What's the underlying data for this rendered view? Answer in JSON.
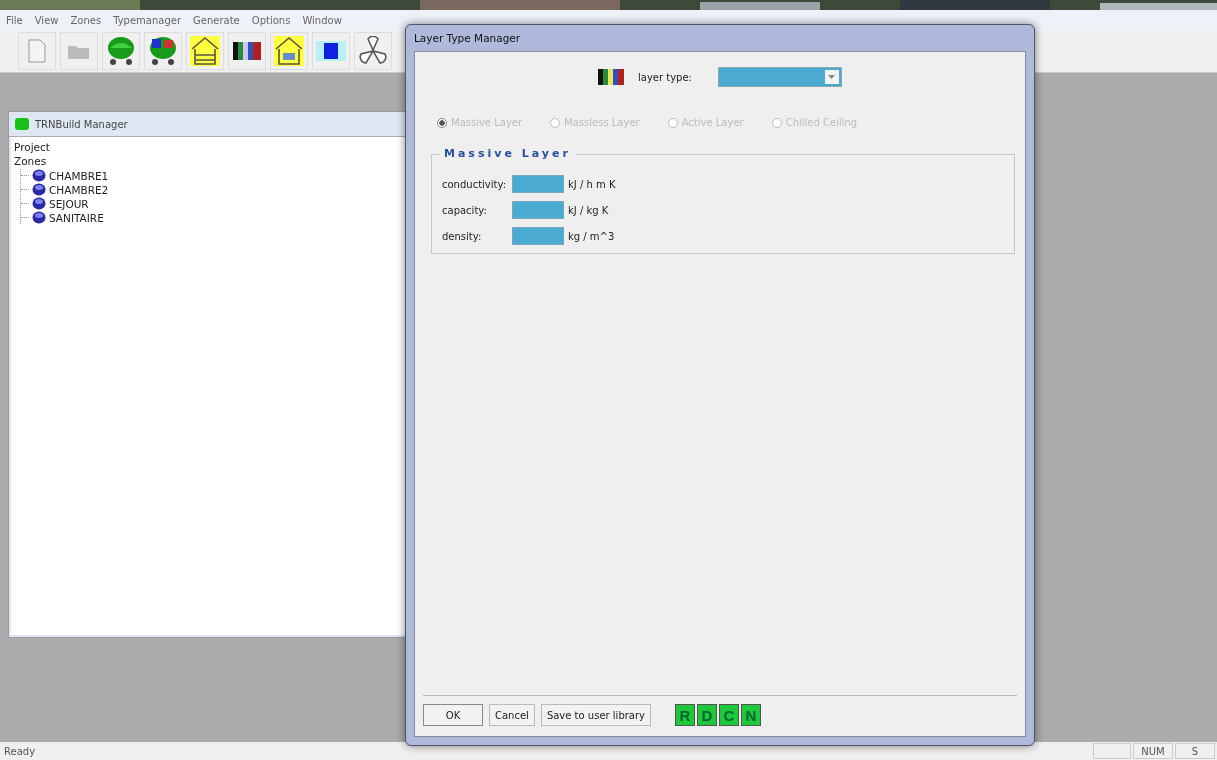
{
  "menu": [
    {
      "label": "File"
    },
    {
      "label": "View"
    },
    {
      "label": "Zones"
    },
    {
      "label": "Typemanager"
    },
    {
      "label": "Generate"
    },
    {
      "label": "Options"
    },
    {
      "label": "Window"
    }
  ],
  "toolbar": [
    {
      "kind": "new"
    },
    {
      "kind": "open"
    },
    {
      "kind": "zone"
    },
    {
      "kind": "zones"
    },
    {
      "kind": "building"
    },
    {
      "kind": "layers"
    },
    {
      "kind": "house-window"
    },
    {
      "kind": "square"
    },
    {
      "kind": "fan"
    }
  ],
  "manager": {
    "title": "TRNBuild Manager",
    "tree": [
      {
        "label": "Project"
      },
      {
        "label": "Zones",
        "children": [
          {
            "label": "CHAMBRE1"
          },
          {
            "label": "CHAMBRE2"
          },
          {
            "label": "SEJOUR"
          },
          {
            "label": "SANITAIRE"
          }
        ]
      }
    ]
  },
  "dialog": {
    "title": "Layer Type Manager",
    "layer_type_label": "layer type:",
    "options": [
      {
        "label": "Massive Layer",
        "selected": true,
        "disabled": true
      },
      {
        "label": "Massless Layer",
        "selected": false,
        "disabled": true
      },
      {
        "label": "Active Layer",
        "selected": false,
        "disabled": true
      },
      {
        "label": "Chilled Ceiling",
        "selected": false,
        "disabled": true
      }
    ],
    "group_title": "Massive Layer",
    "properties": [
      {
        "label": "conductivity:",
        "unit": "kJ / h m K"
      },
      {
        "label": "capacity:",
        "unit": "kJ / kg K"
      },
      {
        "label": "density:",
        "unit": "kg / m^3"
      }
    ],
    "buttons": [
      "OK",
      "Cancel",
      "Save to user library"
    ],
    "letter_buttons": [
      "R",
      "D",
      "C",
      "N"
    ]
  },
  "status_bar": {
    "message": "Ready",
    "indicators": [
      "NUM",
      "S"
    ]
  }
}
